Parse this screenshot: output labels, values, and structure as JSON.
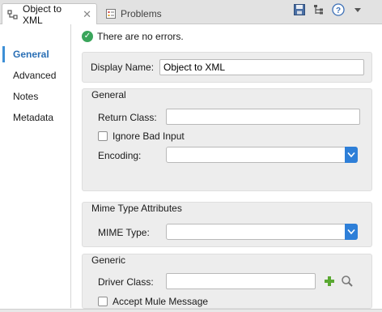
{
  "tabs": {
    "active_label": "Object to XML",
    "close_glyph": "✕",
    "inactive_label": "Problems"
  },
  "toolbar": {
    "icons": [
      "save-icon",
      "tree-icon",
      "help-icon",
      "view-menu-icon"
    ]
  },
  "sidebar": {
    "items": [
      {
        "label": "General",
        "selected": true
      },
      {
        "label": "Advanced",
        "selected": false
      },
      {
        "label": "Notes",
        "selected": false
      },
      {
        "label": "Metadata",
        "selected": false
      }
    ]
  },
  "status": {
    "text": "There are no errors."
  },
  "display": {
    "label": "Display Name:",
    "value": "Object to XML"
  },
  "general": {
    "title": "General",
    "return_class_label": "Return Class:",
    "return_class_value": "",
    "ignore_bad_input_label": "Ignore Bad Input",
    "ignore_bad_input_checked": false,
    "encoding_label": "Encoding:",
    "encoding_value": ""
  },
  "mime": {
    "title": "Mime Type Attributes",
    "mime_type_label": "MIME Type:",
    "mime_type_value": ""
  },
  "generic": {
    "title": "Generic",
    "driver_class_label": "Driver Class:",
    "driver_class_value": "",
    "accept_mule_message_label": "Accept Mule Message",
    "accept_mule_message_checked": false
  },
  "colors": {
    "accent": "#2e7fd8",
    "selected_nav": "#2a6fb5",
    "ok_green": "#3aa55b"
  }
}
